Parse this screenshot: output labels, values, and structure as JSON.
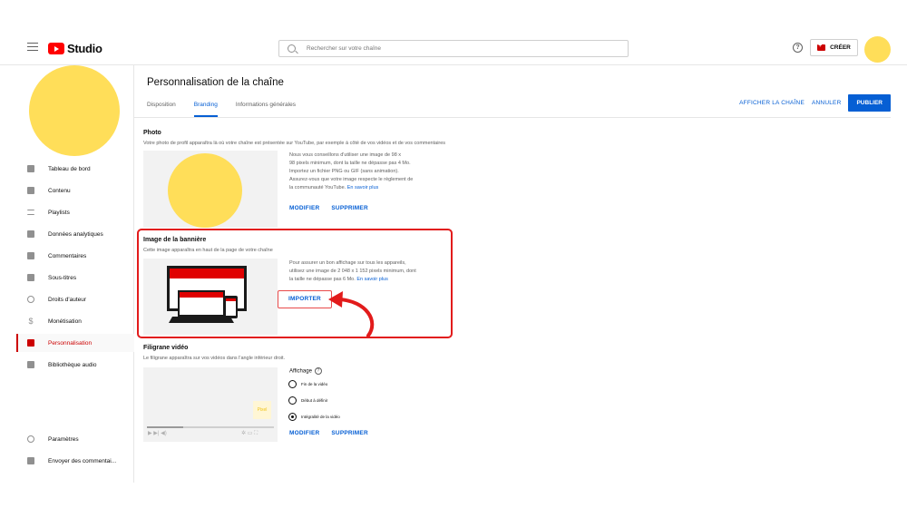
{
  "header": {
    "logo_text": "Studio",
    "search_placeholder": "Rechercher sur votre chaîne",
    "help_glyph": "?",
    "create_label": "CRÉER"
  },
  "sidebar": {
    "items": [
      {
        "label": "Tableau de bord",
        "icon": "dashboard-icon"
      },
      {
        "label": "Contenu",
        "icon": "content-icon"
      },
      {
        "label": "Playlists",
        "icon": "playlist-icon"
      },
      {
        "label": "Données analytiques",
        "icon": "analytics-icon"
      },
      {
        "label": "Commentaires",
        "icon": "comments-icon"
      },
      {
        "label": "Sous-titres",
        "icon": "subtitles-icon"
      },
      {
        "label": "Droits d'auteur",
        "icon": "copyright-icon"
      },
      {
        "label": "Monétisation",
        "icon": "dollar-icon"
      },
      {
        "label": "Personnalisation",
        "icon": "magic-wand-icon",
        "active": true
      },
      {
        "label": "Bibliothèque audio",
        "icon": "audio-library-icon"
      }
    ],
    "bottom": [
      {
        "label": "Paramètres",
        "icon": "gear-icon"
      },
      {
        "label": "Envoyer des commentai...",
        "icon": "feedback-icon"
      }
    ]
  },
  "main": {
    "title": "Personnalisation de la chaîne",
    "tabs": [
      {
        "label": "Disposition"
      },
      {
        "label": "Branding",
        "active": true
      },
      {
        "label": "Informations générales"
      }
    ],
    "actions": {
      "view_channel": "AFFICHER LA CHAÎNE",
      "cancel": "ANNULER",
      "publish": "PUBLIER"
    },
    "photo": {
      "title": "Photo",
      "desc": "Votre photo de profil apparaîtra là où votre chaîne est présentée sur YouTube, par exemple à côté de vos vidéos et de vos commentaires",
      "info_lines": [
        "Nous vous conseillons d'utiliser une image de 98 x",
        "98 pixels minimum, dont la taille ne dépasse pas 4 Mo.",
        "Importez un fichier PNG ou GIF (sans animation).",
        "Assurez-vous que votre image respecte le règlement de"
      ],
      "info_last": "la communauté YouTube.",
      "learn_more": "En savoir plus",
      "modify": "MODIFIER",
      "delete": "SUPPRIMER"
    },
    "banner": {
      "title": "Image de la bannière",
      "desc": "Cette image apparaîtra en haut de la page de votre chaîne",
      "info_lines": [
        "Pour assurer un bon affichage sur tous les appareils,",
        "utilisez une image de 2 048 x 1 152 pixels minimum, dont"
      ],
      "info_last": "la taille ne dépasse pas 6 Mo.",
      "learn_more": "En savoir plus",
      "import": "IMPORTER"
    },
    "watermark": {
      "title": "Filigrane vidéo",
      "desc": "Le filigrane apparaîtra sur vos vidéos dans l'angle inférieur droit.",
      "brand_text": "Pixel",
      "display_label": "Affichage",
      "help_glyph": "?",
      "options": [
        {
          "label": "Fin de la vidéo",
          "selected": false
        },
        {
          "label": "Début à définir",
          "selected": false
        },
        {
          "label": "Intégralité de la vidéo",
          "selected": true
        }
      ],
      "controls_left": "▶ ▶| ◀)",
      "controls_right": "✲ ▭ ⛶",
      "modify": "MODIFIER",
      "delete": "SUPPRIMER"
    }
  },
  "colors": {
    "accent": "#065fd4",
    "brand_red": "#ff0000",
    "avatar": "#ffde59",
    "highlight": "#e21b1b"
  }
}
